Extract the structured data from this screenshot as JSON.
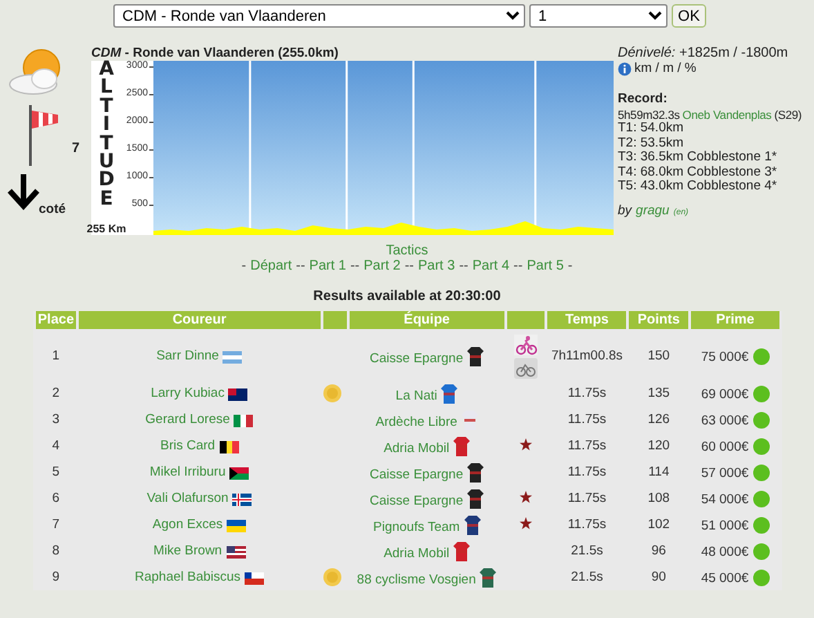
{
  "race_select": {
    "value": "CDM - Ronde van Vlaanderen"
  },
  "stage_select": {
    "value": "1"
  },
  "ok_button": "OK",
  "left_panel": {
    "wind_force": "7",
    "terrain": "coté"
  },
  "profile": {
    "title": "*CDM* - Ronde van Vlaanderen (255.0km)",
    "axis_word": "ALTITUDE",
    "distance": "255 Km",
    "altitude_ticks": [
      "3000",
      "2500",
      "2000",
      "1500",
      "1000",
      "500"
    ]
  },
  "info": {
    "elevation": "*Dénivelé:* +1825m / -1800m",
    "units": "km / m / %",
    "record_label": "Record:",
    "record_time": "5h59m32.3s",
    "record_holder": "Oneb Vandenplas",
    "record_season": "(S29)",
    "sections": [
      "T1: 54.0km",
      "T2: 53.5km",
      "T3: 36.5km Cobblestone 1*",
      "T4: 68.0km Cobblestone 3*",
      "T5: 43.0km Cobblestone 4*"
    ],
    "by": "by",
    "author": "gragu",
    "lang": "(en)"
  },
  "tactics": {
    "title": "Tactics",
    "parts": [
      {
        "kind": "sep",
        "text": "-"
      },
      {
        "kind": "link",
        "text": "Départ"
      },
      {
        "kind": "sep",
        "text": "--"
      },
      {
        "kind": "link",
        "text": "Part 1"
      },
      {
        "kind": "sep",
        "text": "--"
      },
      {
        "kind": "link",
        "text": "Part 2"
      },
      {
        "kind": "sep",
        "text": "--"
      },
      {
        "kind": "link",
        "text": "Part 3"
      },
      {
        "kind": "sep",
        "text": "--"
      },
      {
        "kind": "link",
        "text": "Part 4"
      },
      {
        "kind": "sep",
        "text": "--"
      },
      {
        "kind": "link",
        "text": "Part 5"
      },
      {
        "kind": "sep",
        "text": "-"
      }
    ]
  },
  "results_note": "Results available at 20:30:00",
  "table": {
    "columns": [
      {
        "label": "Place"
      },
      {
        "label": "Coureur"
      },
      {},
      {
        "label": "Équipe"
      },
      {},
      {
        "label": "Temps"
      },
      {
        "label": "Points"
      },
      {
        "label": "Prime"
      }
    ],
    "rows": [
      {
        "place": "1",
        "rider": "Sarr Dinne",
        "bonus": false,
        "team": "Caisse Epargne",
        "jersey": {
          "color": "#222222"
        },
        "star": false,
        "leader": true,
        "time": "7h11m00.8s",
        "points": "150",
        "prime": "75 000€"
      },
      {
        "place": "2",
        "rider": "Larry Kubiac",
        "bonus": true,
        "team": "La Nati",
        "jersey": {
          "color": "#1e6fd0"
        },
        "star": false,
        "leader": false,
        "time": "11.75s",
        "points": "135",
        "prime": "69 000€"
      },
      {
        "place": "3",
        "rider": "Gerard Lorese",
        "bonus": false,
        "team": "Ardèche Libre",
        "jersey": {
          "color": "#e8e8f0"
        },
        "star": false,
        "leader": false,
        "time": "11.75s",
        "points": "126",
        "prime": "63 000€"
      },
      {
        "place": "4",
        "rider": "Bris Card",
        "bonus": false,
        "team": "Adria Mobil",
        "jersey": {
          "color": "#d0202a"
        },
        "star": true,
        "leader": false,
        "time": "11.75s",
        "points": "120",
        "prime": "60 000€"
      },
      {
        "place": "5",
        "rider": "Mikel Irriburu",
        "bonus": false,
        "team": "Caisse Epargne",
        "jersey": {
          "color": "#222222"
        },
        "star": false,
        "leader": false,
        "time": "11.75s",
        "points": "114",
        "prime": "57 000€"
      },
      {
        "place": "6",
        "rider": "Vali Olafurson",
        "bonus": false,
        "team": "Caisse Epargne",
        "jersey": {
          "color": "#222222"
        },
        "star": true,
        "leader": false,
        "time": "11.75s",
        "points": "108",
        "prime": "54 000€"
      },
      {
        "place": "7",
        "rider": "Agon Exces",
        "bonus": false,
        "team": "Pignoufs Team",
        "jersey": {
          "color": "#1f3a7a"
        },
        "star": true,
        "leader": false,
        "time": "11.75s",
        "points": "102",
        "prime": "51 000€"
      },
      {
        "place": "8",
        "rider": "Mike Brown",
        "bonus": false,
        "team": "Adria Mobil",
        "jersey": {
          "color": "#d0202a"
        },
        "star": false,
        "leader": false,
        "time": "21.5s",
        "points": "96",
        "prime": "48 000€"
      },
      {
        "place": "9",
        "rider": "Raphael Babiscus",
        "bonus": true,
        "team": "88 cyclisme Vosgien",
        "jersey": {
          "color": "#2a6a50"
        },
        "star": false,
        "leader": false,
        "time": "21.5s",
        "points": "90",
        "prime": "45 000€"
      }
    ]
  }
}
